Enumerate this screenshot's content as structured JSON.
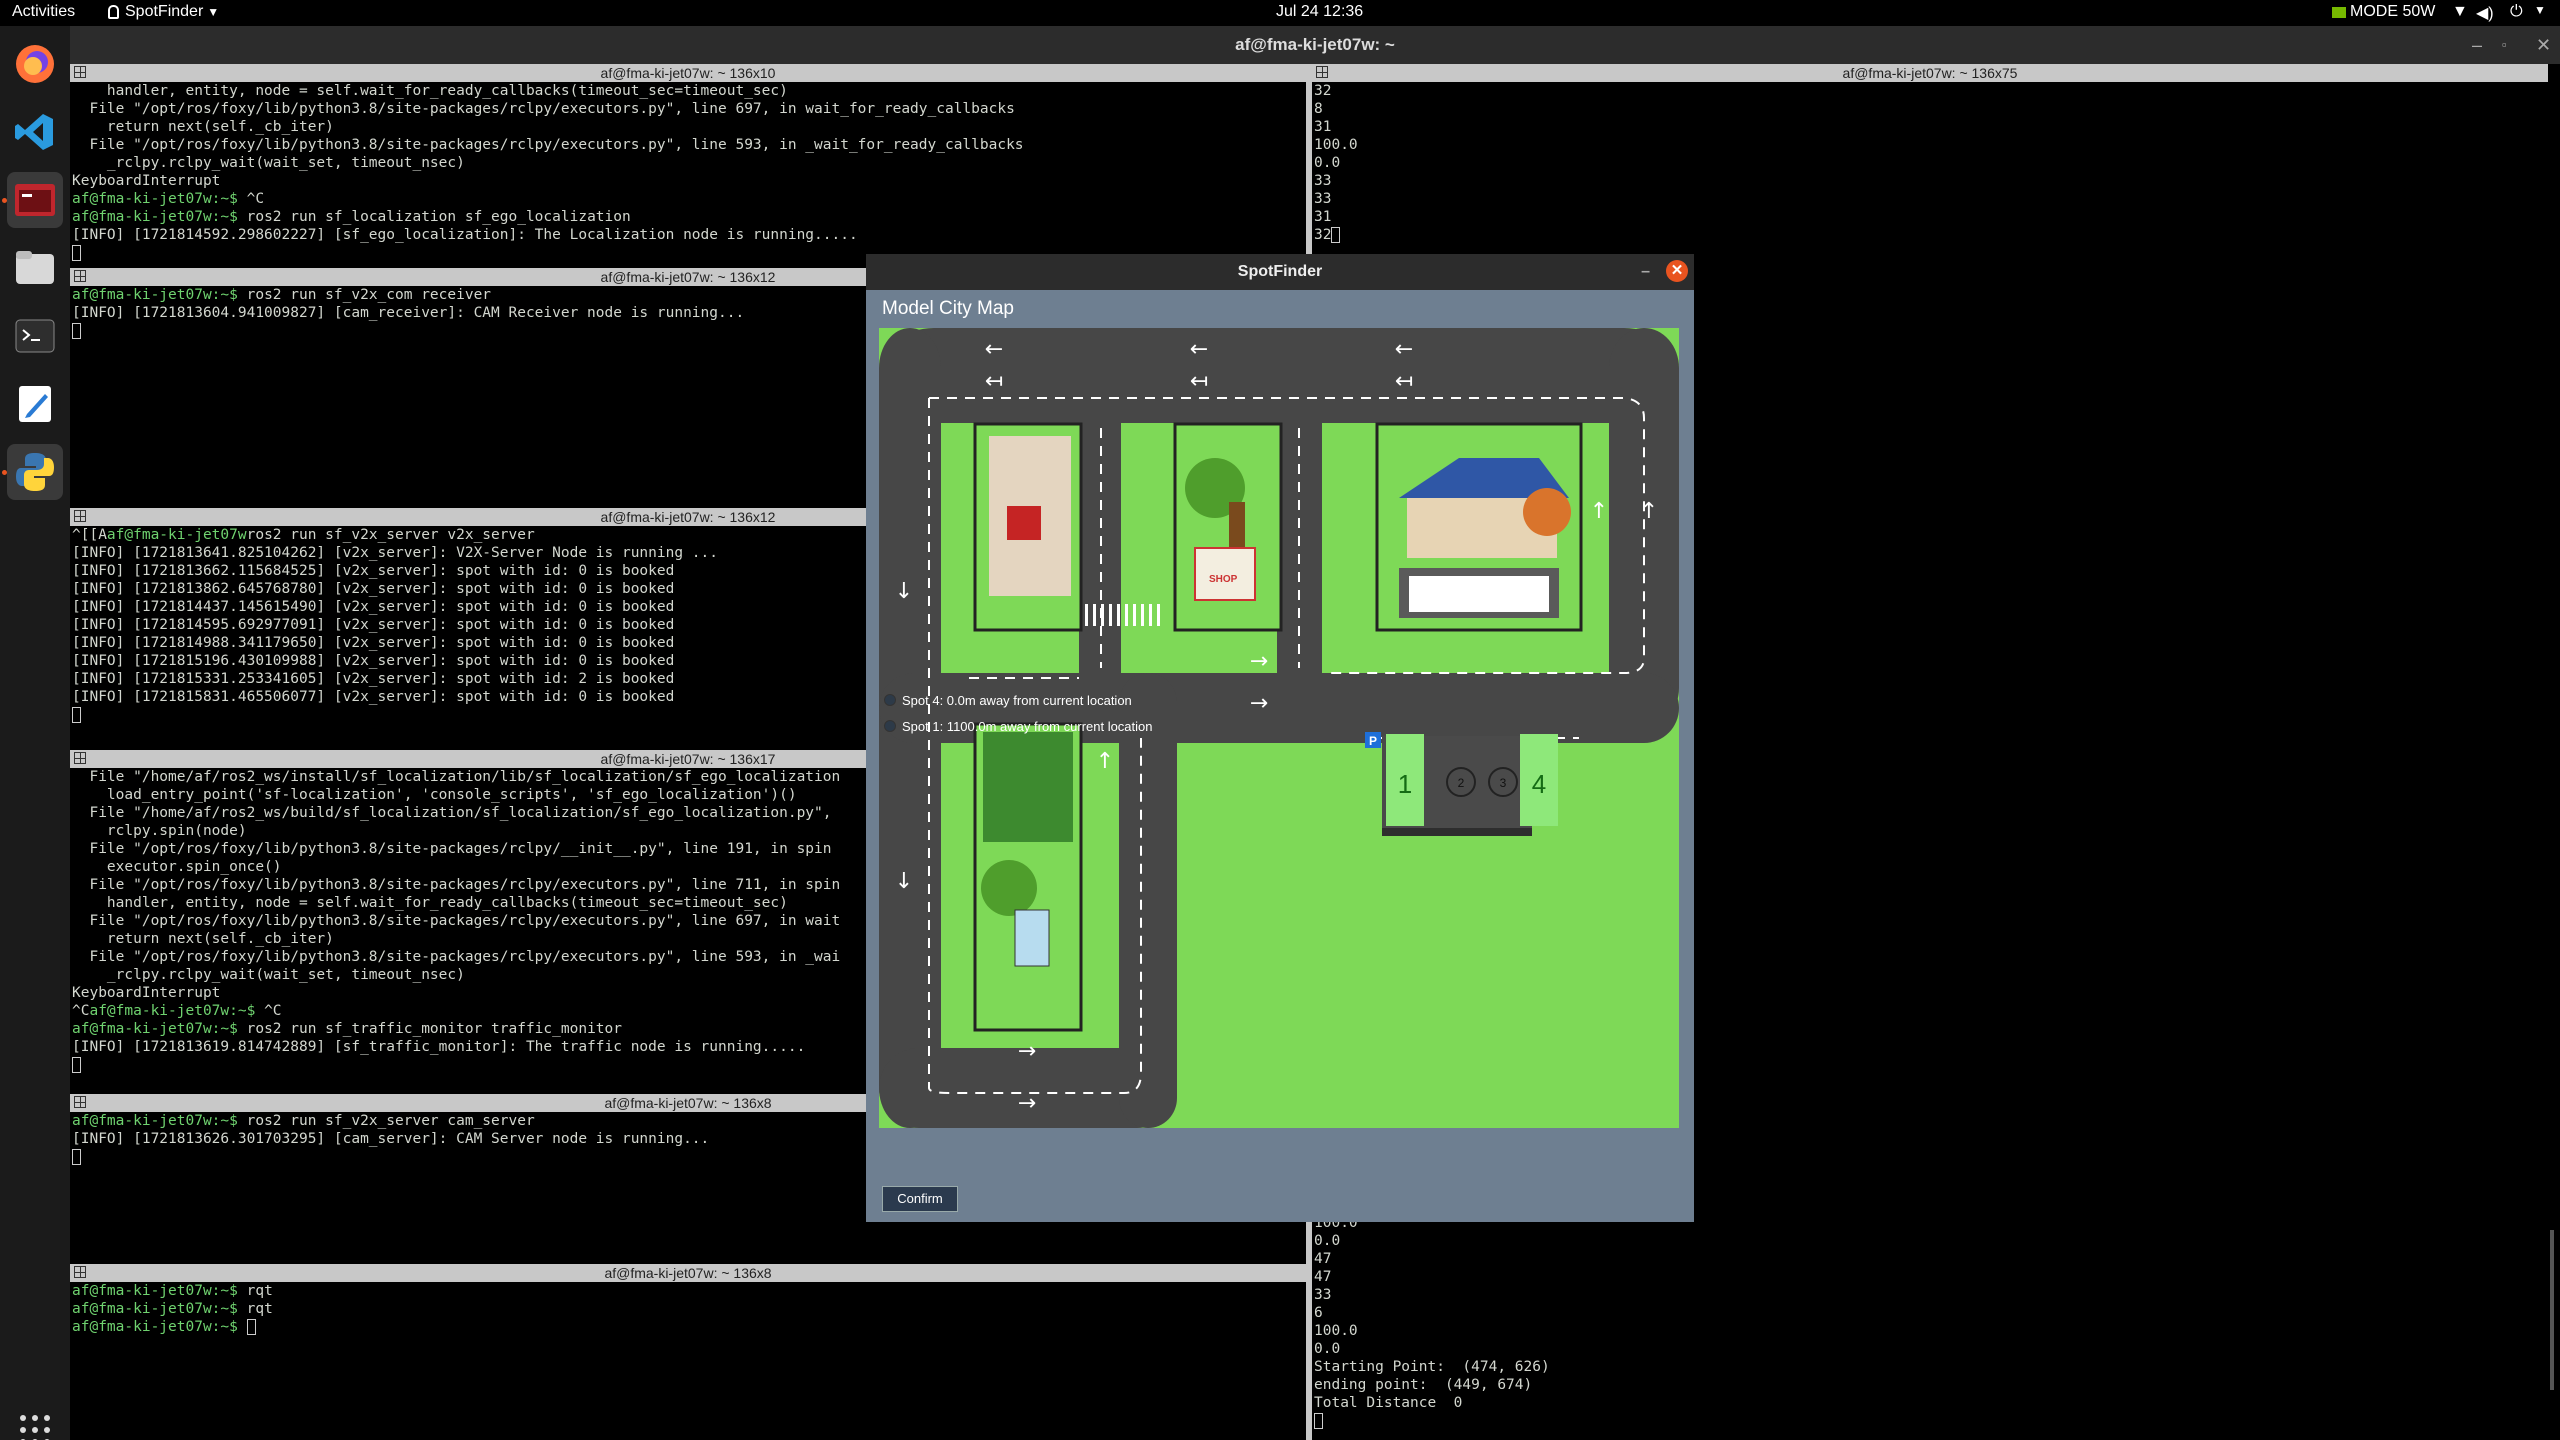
{
  "topbar": {
    "activities": "Activities",
    "app_menu": "SpotFinder",
    "clock": "Jul 24  12:36",
    "mode": "MODE 50W"
  },
  "window": {
    "title": "af@fma-ki-jet07w: ~"
  },
  "terminals": [
    {
      "title": "af@fma-ki-jet07w: ~ 136x10",
      "lines": [
        "    handler, entity, node = self.wait_for_ready_callbacks(timeout_sec=timeout_sec)",
        "  File \"/opt/ros/foxy/lib/python3.8/site-packages/rclpy/executors.py\", line 697, in wait_for_ready_callbacks",
        "    return next(self._cb_iter)",
        "  File \"/opt/ros/foxy/lib/python3.8/site-packages/rclpy/executors.py\", line 593, in _wait_for_ready_callbacks",
        "    _rclpy.rclpy_wait(wait_set, timeout_nsec)",
        "KeyboardInterrupt",
        "af@fma-ki-jet07w:~$ ^C",
        "af@fma-ki-jet07w:~$ ros2 run sf_localization sf_ego_localization",
        "[INFO] [1721814592.298602227] [sf_ego_localization]: The Localization node is running.....",
        ""
      ]
    },
    {
      "title": "af@fma-ki-jet07w: ~ 136x12",
      "lines": [
        "af@fma-ki-jet07w:~$ ros2 run sf_v2x_com receiver",
        "[INFO] [1721813604.941009827] [cam_receiver]: CAM Receiver node is running...",
        ""
      ]
    },
    {
      "title": "af@fma-ki-jet07w: ~ 136x12",
      "lines": [
        "^[[Aaf@fma-ki-jet07wros2 run sf_v2x_server v2x_server",
        "[INFO] [1721813641.825104262] [v2x_server]: V2X-Server Node is running ...",
        "[INFO] [1721813662.115684525] [v2x_server]: spot with id: 0 is booked",
        "[INFO] [1721813862.645768780] [v2x_server]: spot with id: 0 is booked",
        "[INFO] [1721814437.145615490] [v2x_server]: spot with id: 0 is booked",
        "[INFO] [1721814595.692977091] [v2x_server]: spot with id: 0 is booked",
        "[INFO] [1721814988.341179650] [v2x_server]: spot with id: 0 is booked",
        "[INFO] [1721815196.430109988] [v2x_server]: spot with id: 0 is booked",
        "[INFO] [1721815331.253341605] [v2x_server]: spot with id: 2 is booked",
        "[INFO] [1721815831.465506077] [v2x_server]: spot with id: 0 is booked",
        ""
      ]
    },
    {
      "title": "af@fma-ki-jet07w: ~ 136x17",
      "lines": [
        "  File \"/home/af/ros2_ws/install/sf_localization/lib/sf_localization/sf_ego_localization",
        "    load_entry_point('sf-localization', 'console_scripts', 'sf_ego_localization')()",
        "  File \"/home/af/ros2_ws/build/sf_localization/sf_localization/sf_ego_localization.py\",",
        "    rclpy.spin(node)",
        "  File \"/opt/ros/foxy/lib/python3.8/site-packages/rclpy/__init__.py\", line 191, in spin",
        "    executor.spin_once()",
        "  File \"/opt/ros/foxy/lib/python3.8/site-packages/rclpy/executors.py\", line 711, in spin",
        "    handler, entity, node = self.wait_for_ready_callbacks(timeout_sec=timeout_sec)",
        "  File \"/opt/ros/foxy/lib/python3.8/site-packages/rclpy/executors.py\", line 697, in wait",
        "    return next(self._cb_iter)",
        "  File \"/opt/ros/foxy/lib/python3.8/site-packages/rclpy/executors.py\", line 593, in _wai",
        "    _rclpy.rclpy_wait(wait_set, timeout_nsec)",
        "KeyboardInterrupt",
        "^Caf@fma-ki-jet07w:~$ ^C",
        "af@fma-ki-jet07w:~$ ros2 run sf_traffic_monitor traffic_monitor",
        "[INFO] [1721813619.814742889] [sf_traffic_monitor]: The traffic node is running.....",
        ""
      ]
    },
    {
      "title": "af@fma-ki-jet07w: ~ 136x8",
      "lines": [
        "af@fma-ki-jet07w:~$ ros2 run sf_v2x_server cam_server",
        "[INFO] [1721813626.301703295] [cam_server]: CAM Server node is running...",
        ""
      ]
    },
    {
      "title": "af@fma-ki-jet07w: ~ 136x8",
      "lines": [
        "af@fma-ki-jet07w:~$ rqt",
        "af@fma-ki-jet07w:~$ rqt",
        "af@fma-ki-jet07w:~$ "
      ]
    },
    {
      "title": "af@fma-ki-jet07w: ~ 136x75",
      "lines_top": [
        "32",
        "8",
        "31",
        "100.0",
        "0.0",
        "33",
        "33",
        "31",
        "32"
      ],
      "lines_bottom": [
        "100.0",
        "0.0",
        "47",
        "47",
        "33",
        "6",
        "100.0",
        "0.0",
        "Starting Point:  (474, 626)",
        "ending point:  (449, 674)",
        "Total Distance  0",
        ""
      ]
    }
  ],
  "dialog": {
    "title": "SpotFinder",
    "map_title": "Model City Map",
    "spots": [
      "1",
      "2",
      "3",
      "4"
    ],
    "parking_sign": "P",
    "shop_label": "SHOP",
    "options": [
      "Spot 4: 0.0m away from current location",
      "Spot 1: 1100.0m away from current location"
    ],
    "confirm": "Confirm"
  },
  "colors": {
    "grass": "#7ed957",
    "road": "#474747",
    "prompt": "#6fd26f",
    "accent": "#e95420"
  }
}
